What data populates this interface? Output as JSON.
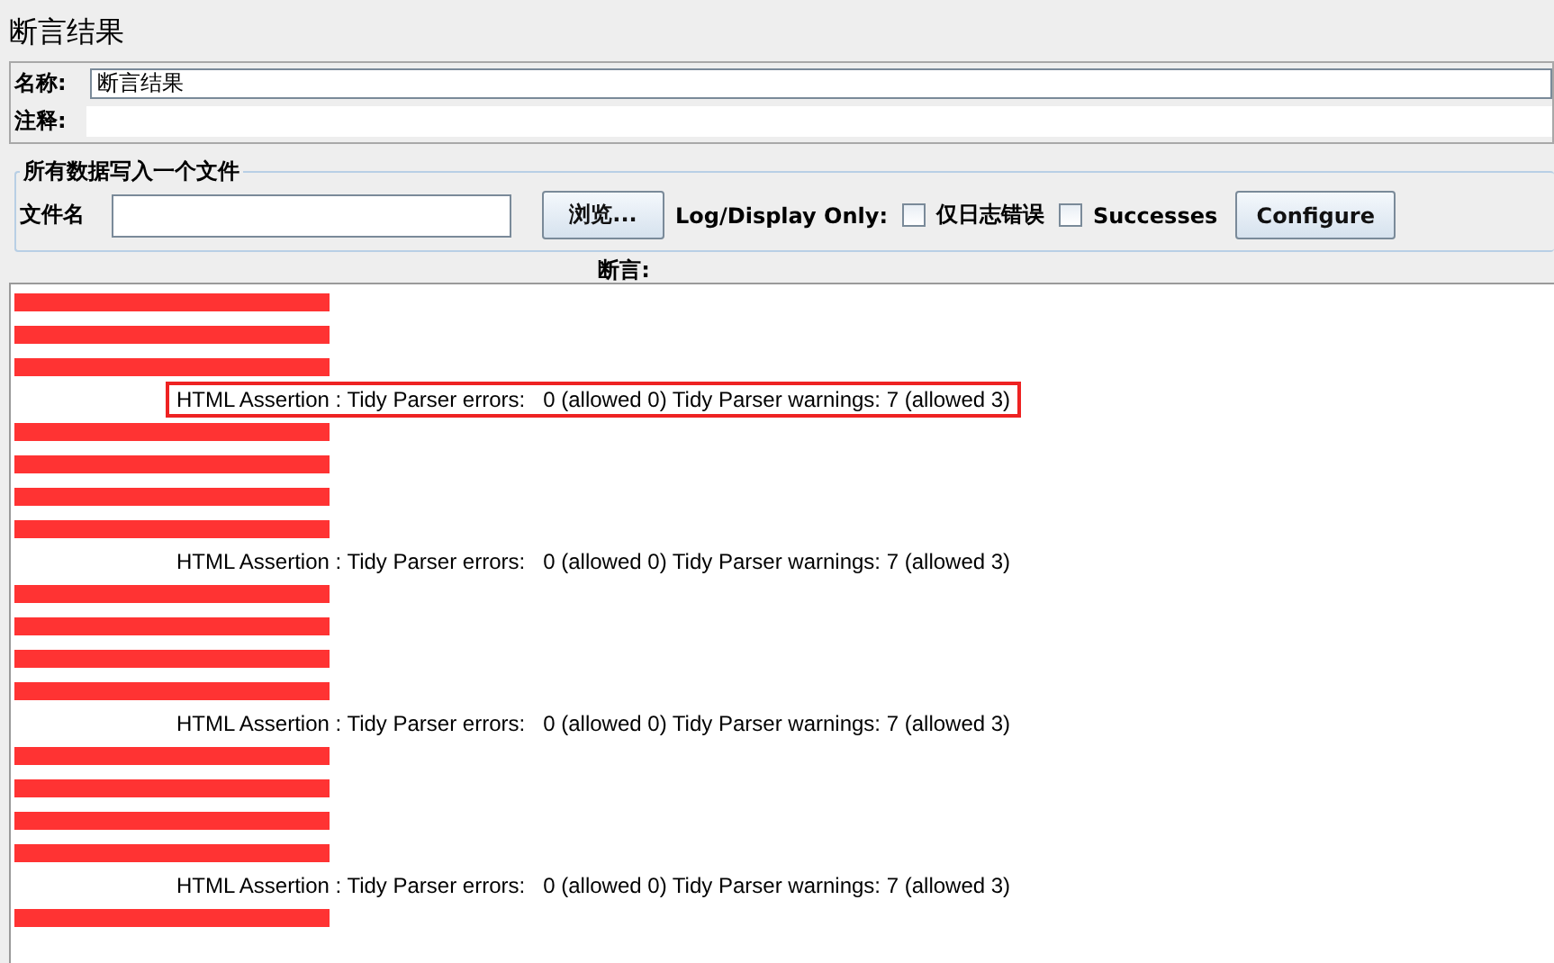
{
  "window": {
    "title": "断言结果"
  },
  "name_field": {
    "label": "名称:",
    "value": "断言结果"
  },
  "comment_field": {
    "label": "注释:"
  },
  "file_group": {
    "legend": "所有数据写入一个文件",
    "file_label": "文件名",
    "browse_button": "浏览...",
    "log_label": "Log/Display Only:",
    "checkboxes": [
      {
        "label": "仅日志错误",
        "checked": false
      },
      {
        "label": "Successes",
        "checked": false
      }
    ],
    "configure_button": "Configure"
  },
  "results": {
    "header": "断言:",
    "rows": [
      {
        "kind": "redacted"
      },
      {
        "kind": "redacted"
      },
      {
        "kind": "redacted"
      },
      {
        "kind": "assertion",
        "text": "HTML Assertion : Tidy Parser errors:   0 (allowed 0) Tidy Parser warnings: 7 (allowed 3)",
        "highlighted": true
      },
      {
        "kind": "redacted"
      },
      {
        "kind": "redacted"
      },
      {
        "kind": "redacted"
      },
      {
        "kind": "redacted"
      },
      {
        "kind": "assertion",
        "text": "HTML Assertion : Tidy Parser errors:   0 (allowed 0) Tidy Parser warnings: 7 (allowed 3)",
        "highlighted": false
      },
      {
        "kind": "redacted"
      },
      {
        "kind": "redacted"
      },
      {
        "kind": "redacted"
      },
      {
        "kind": "redacted"
      },
      {
        "kind": "assertion",
        "text": "HTML Assertion : Tidy Parser errors:   0 (allowed 0) Tidy Parser warnings: 7 (allowed 3)",
        "highlighted": false
      },
      {
        "kind": "redacted"
      },
      {
        "kind": "redacted"
      },
      {
        "kind": "redacted"
      },
      {
        "kind": "redacted"
      },
      {
        "kind": "assertion",
        "text": "HTML Assertion : Tidy Parser errors:   0 (allowed 0) Tidy Parser warnings: 7 (allowed 3)",
        "highlighted": false
      },
      {
        "kind": "redacted"
      }
    ]
  }
}
